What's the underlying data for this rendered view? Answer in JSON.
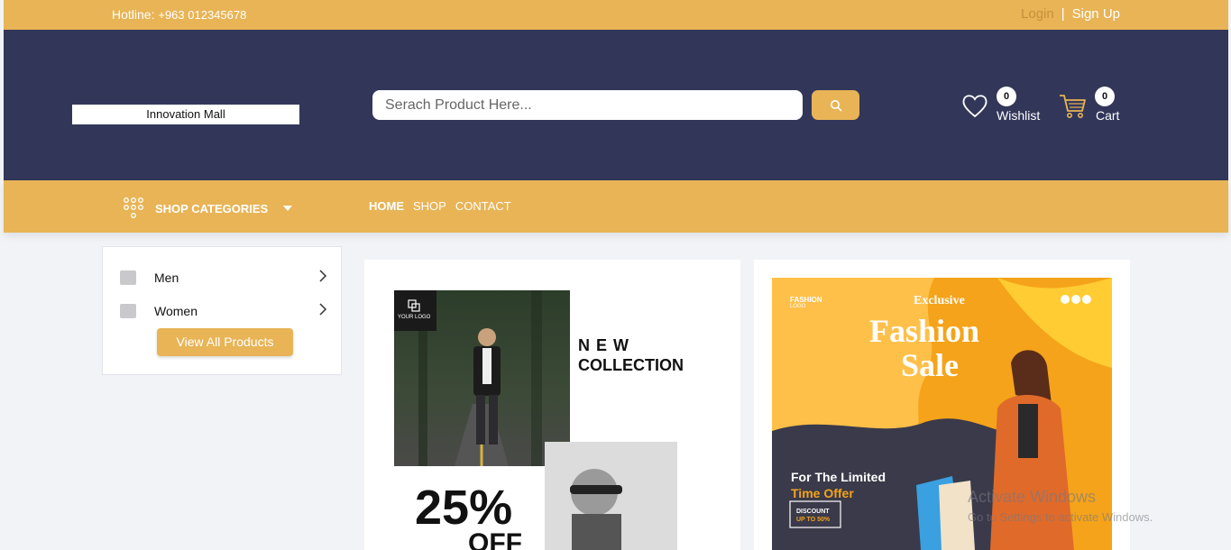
{
  "topbar": {
    "hotline_label": "Hotline: ",
    "hotline_number": "+963 012345678",
    "login": "Login",
    "separator": "|",
    "signup": "Sign Up"
  },
  "header": {
    "logo_text": "Innovation Mall",
    "search_placeholder": "Serach Product Here...",
    "wishlist_label": "Wishlist",
    "wishlist_count": "0",
    "cart_label": "Cart",
    "cart_count": "0"
  },
  "nav": {
    "categories": "SHOP CATEGORIES",
    "links": [
      "HOME",
      "SHOP",
      "CONTACT"
    ]
  },
  "sidebar": {
    "items": [
      {
        "label": "Men"
      },
      {
        "label": "Women"
      }
    ],
    "view_all": "View All Products"
  },
  "banner1": {
    "logo_text": "YOUR LOGO",
    "line1": "N E W",
    "line2": "COLLECTION",
    "discount": "25%",
    "off": "OFF"
  },
  "banner2": {
    "brand_top": "FASHION",
    "brand_sub": "LOGO",
    "exclusive": "Exclusive",
    "title1": "Fashion",
    "title2": "Sale",
    "limited1": "For The Limited",
    "limited2": "Time Offer",
    "discount_line1": "DISCOUNT",
    "discount_line2": "UP TO 50%"
  },
  "watermark": {
    "title": "Activate Windows",
    "subtitle": "Go to Settings to activate Windows."
  },
  "colors": {
    "accent": "#e8b456",
    "header_bg": "#32375a",
    "page_bg": "#f1f3f7",
    "banner_orange": "#f5a31a"
  }
}
